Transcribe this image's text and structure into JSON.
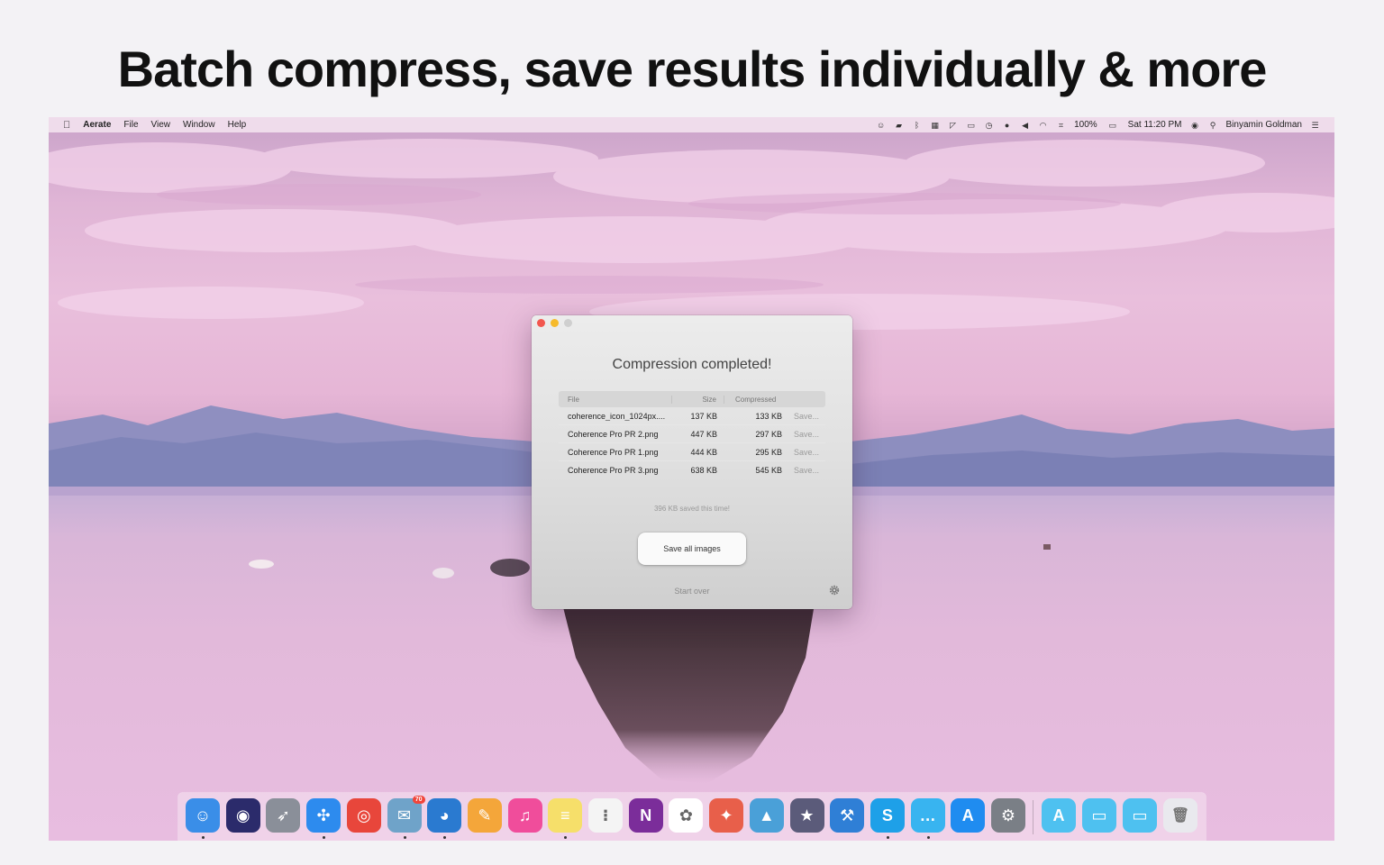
{
  "headline": "Batch compress, save results individually & more",
  "menubar": {
    "app_name": "Aerate",
    "items": [
      "File",
      "View",
      "Window",
      "Help"
    ],
    "battery": "100%",
    "clock": "Sat 11:20 PM",
    "user": "Binyamin Goldman"
  },
  "window": {
    "title": "Compression completed!",
    "columns": {
      "file": "File",
      "size": "Size",
      "compressed": "Compressed"
    },
    "rows": [
      {
        "file": "coherence_icon_1024px....",
        "size": "137 KB",
        "compressed": "133 KB",
        "action": "Save..."
      },
      {
        "file": "Coherence Pro PR 2.png",
        "size": "447 KB",
        "compressed": "297 KB",
        "action": "Save..."
      },
      {
        "file": "Coherence Pro PR 1.png",
        "size": "444 KB",
        "compressed": "295 KB",
        "action": "Save..."
      },
      {
        "file": "Coherence Pro PR 3.png",
        "size": "638 KB",
        "compressed": "545 KB",
        "action": "Save..."
      }
    ],
    "saved_note": "396 KB saved this time!",
    "save_all_label": "Save all images",
    "start_over_label": "Start over"
  },
  "dock": {
    "apps": [
      {
        "name": "finder-icon",
        "color": "#3a8ee8",
        "glyph": "☺"
      },
      {
        "name": "siri-icon",
        "color": "#2b2b6b",
        "glyph": "◉"
      },
      {
        "name": "launchpad-icon",
        "color": "#8a8f99",
        "glyph": "➶"
      },
      {
        "name": "safari-icon",
        "color": "#2d8bee",
        "glyph": "✣"
      },
      {
        "name": "chrome-icon",
        "color": "#e8463b",
        "glyph": "◎"
      },
      {
        "name": "preview-icon",
        "color": "#6fa3c9",
        "glyph": "✉",
        "badge": "70"
      },
      {
        "name": "tweetbot-icon",
        "color": "#2a7ad0",
        "glyph": "◕"
      },
      {
        "name": "pages-icon",
        "color": "#f4a63a",
        "glyph": "✎"
      },
      {
        "name": "itunes-icon",
        "color": "#f04d9b",
        "glyph": "♫"
      },
      {
        "name": "notes-icon",
        "color": "#f6df6a",
        "glyph": "≡"
      },
      {
        "name": "reminders-icon",
        "color": "#f4f4f4",
        "glyph": "⁝"
      },
      {
        "name": "onenote-icon",
        "color": "#7b2d9a",
        "glyph": "N"
      },
      {
        "name": "photos-icon",
        "color": "#ffffff",
        "glyph": "✿"
      },
      {
        "name": "pixelmator-icon",
        "color": "#e85f4a",
        "glyph": "✦"
      },
      {
        "name": "preview-image-icon",
        "color": "#4aa0d8",
        "glyph": "▲"
      },
      {
        "name": "imovie-icon",
        "color": "#5b5b7a",
        "glyph": "★"
      },
      {
        "name": "xcode-icon",
        "color": "#2f7fd6",
        "glyph": "⚒"
      },
      {
        "name": "skype-icon",
        "color": "#1ea0e8",
        "glyph": "S"
      },
      {
        "name": "messages-icon",
        "color": "#38b4f0",
        "glyph": "…"
      },
      {
        "name": "app-store-icon",
        "color": "#1f8cf0",
        "glyph": "A"
      },
      {
        "name": "system-preferences-icon",
        "color": "#7a7f86",
        "glyph": "⚙"
      }
    ],
    "folders": [
      {
        "name": "applications-folder-icon",
        "color": "#4ec1f0",
        "glyph": "A"
      },
      {
        "name": "documents-folder-icon",
        "color": "#4ec1f0",
        "glyph": "▭"
      },
      {
        "name": "downloads-folder-icon",
        "color": "#4ec1f0",
        "glyph": "▭"
      },
      {
        "name": "trash-icon",
        "color": "#e9e9ee",
        "glyph": "🗑"
      }
    ]
  }
}
